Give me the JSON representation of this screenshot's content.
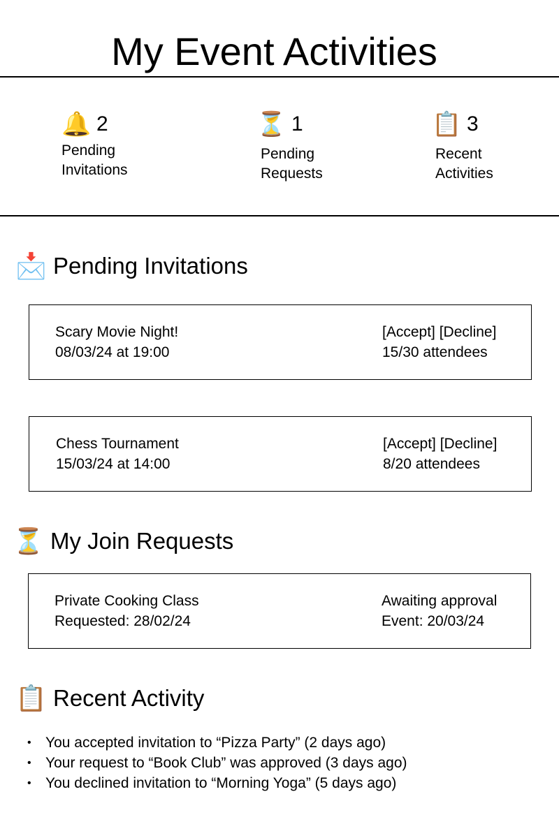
{
  "page": {
    "title": "My Event Activities"
  },
  "stats": [
    {
      "icon": "bell-icon",
      "glyph": "🔔",
      "count": "2",
      "label_line1": "Pending",
      "label_line2": "Invitations"
    },
    {
      "icon": "hourglass-icon",
      "glyph": "⏳",
      "count": "1",
      "label_line1": "Pending",
      "label_line2": "Requests"
    },
    {
      "icon": "clipboard-icon",
      "glyph": "📋",
      "count": "3",
      "label_line1": "Recent",
      "label_line2": "Activities"
    }
  ],
  "sections": {
    "invitations": {
      "icon": "incoming-envelope-icon",
      "glyph": "📩",
      "title": "Pending Invitations"
    },
    "requests": {
      "icon": "hourglass-icon",
      "glyph": "⏳",
      "title": "My Join Requests"
    },
    "activity": {
      "icon": "clipboard-icon",
      "glyph": "📋",
      "title": "Recent Activity"
    }
  },
  "invitations": [
    {
      "name": "Scary Movie Night!",
      "datetime": "08/03/24 at 19:00",
      "accept_label": "[Accept]",
      "decline_label": "[Decline]",
      "attendees": "15/30 attendees"
    },
    {
      "name": "Chess Tournament",
      "datetime": "15/03/24 at 14:00",
      "accept_label": "[Accept]",
      "decline_label": "[Decline]",
      "attendees": "8/20 attendees"
    }
  ],
  "requests": [
    {
      "name": "Private Cooking Class",
      "requested": "Requested: 28/02/24",
      "status": "Awaiting approval",
      "event_date": "Event: 20/03/24"
    }
  ],
  "recent_activity": {
    "bullet": "•",
    "items": [
      "You accepted invitation to “Pizza Party” (2 days ago)",
      "Your request to “Book Club” was approved (3 days ago)",
      "You declined invitation to “Morning Yoga” (5 days ago)"
    ]
  }
}
